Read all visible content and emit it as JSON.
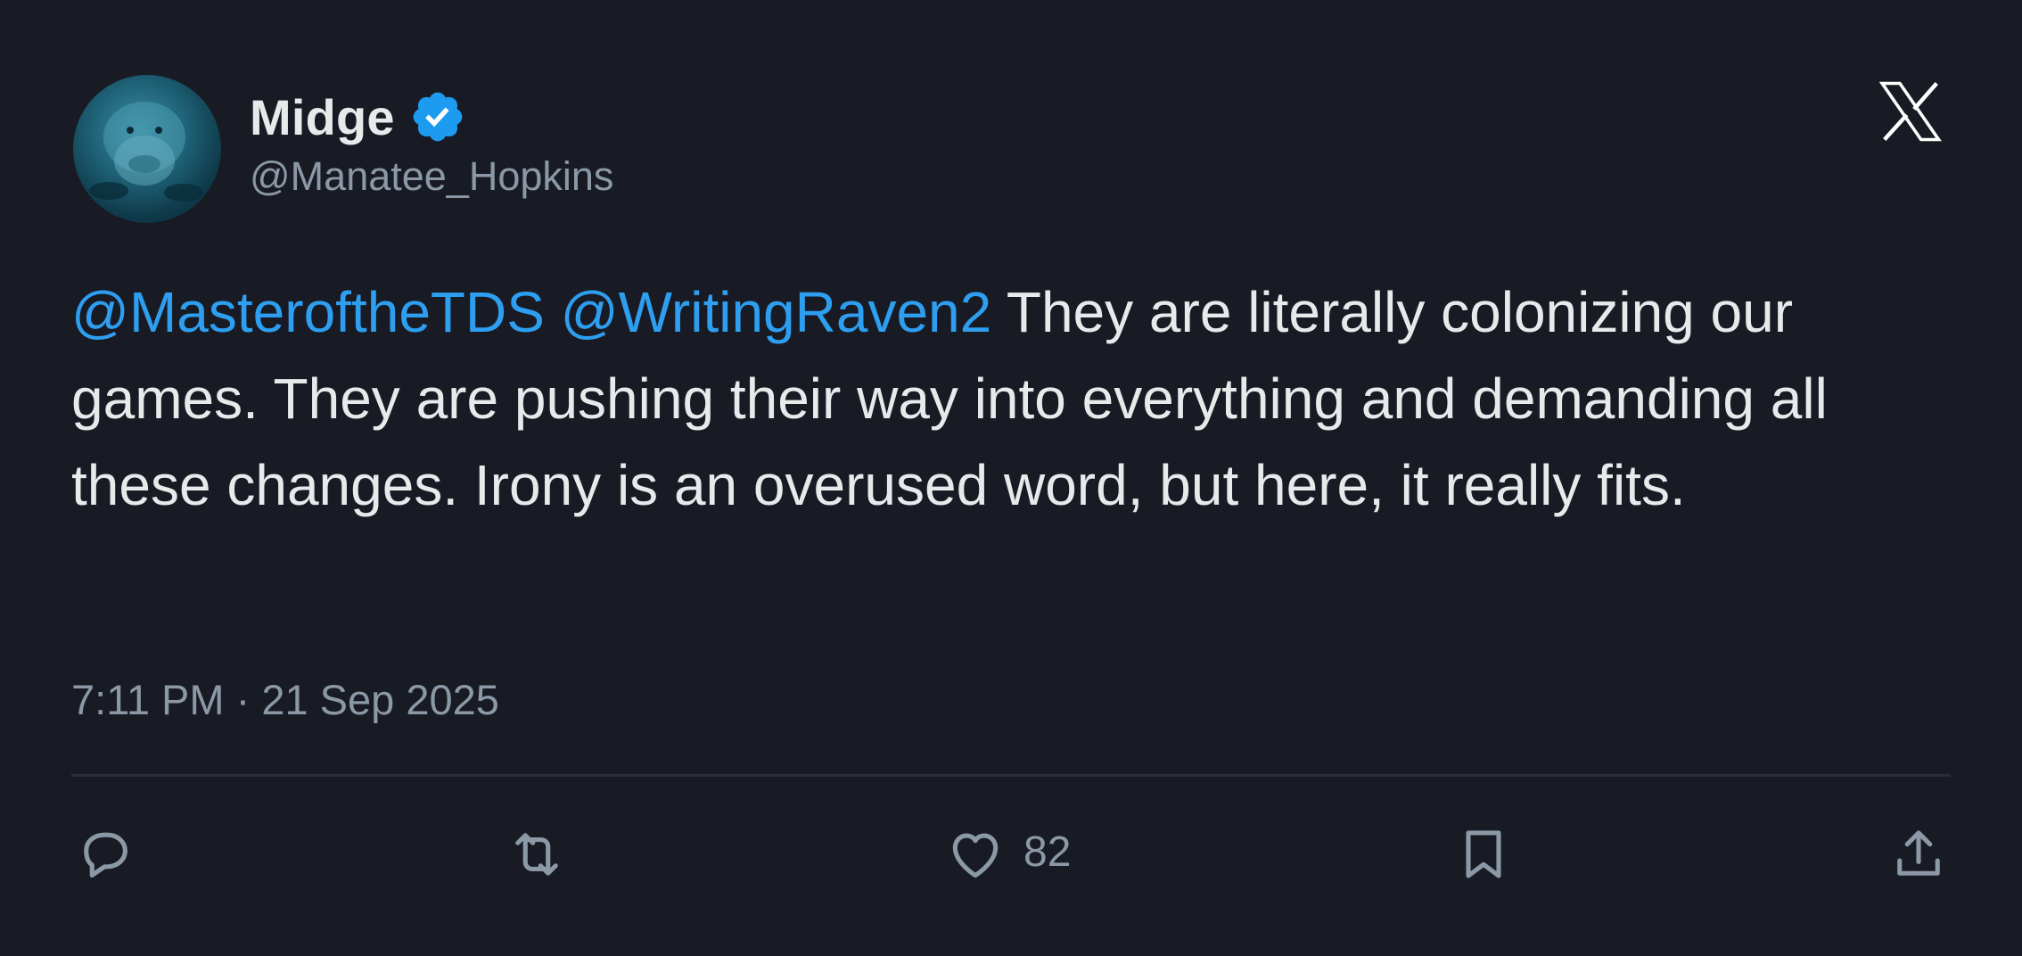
{
  "author": {
    "display_name": "Midge",
    "handle": "@Manatee_Hopkins",
    "verified": true,
    "avatar_icon": "manatee-avatar"
  },
  "tweet": {
    "mentions": [
      "@MasteroftheTDS",
      "@WritingRaven2"
    ],
    "body": "They are literally colonizing our games. They are pushing their way into everything and demanding all these changes. Irony is an overused word, but here, it really fits.",
    "timestamp": "7:11 PM · 21 Sep 2025"
  },
  "actions": {
    "reply_icon": "reply-icon",
    "retweet_icon": "retweet-icon",
    "like_icon": "heart-icon",
    "like_count": "82",
    "bookmark_icon": "bookmark-icon",
    "share_icon": "share-icon"
  },
  "colors": {
    "background": "#181b23",
    "text": "#e7e9ea",
    "muted": "#8b98a5",
    "mention": "#2e9ef0",
    "verified": "#1d9bf0"
  }
}
